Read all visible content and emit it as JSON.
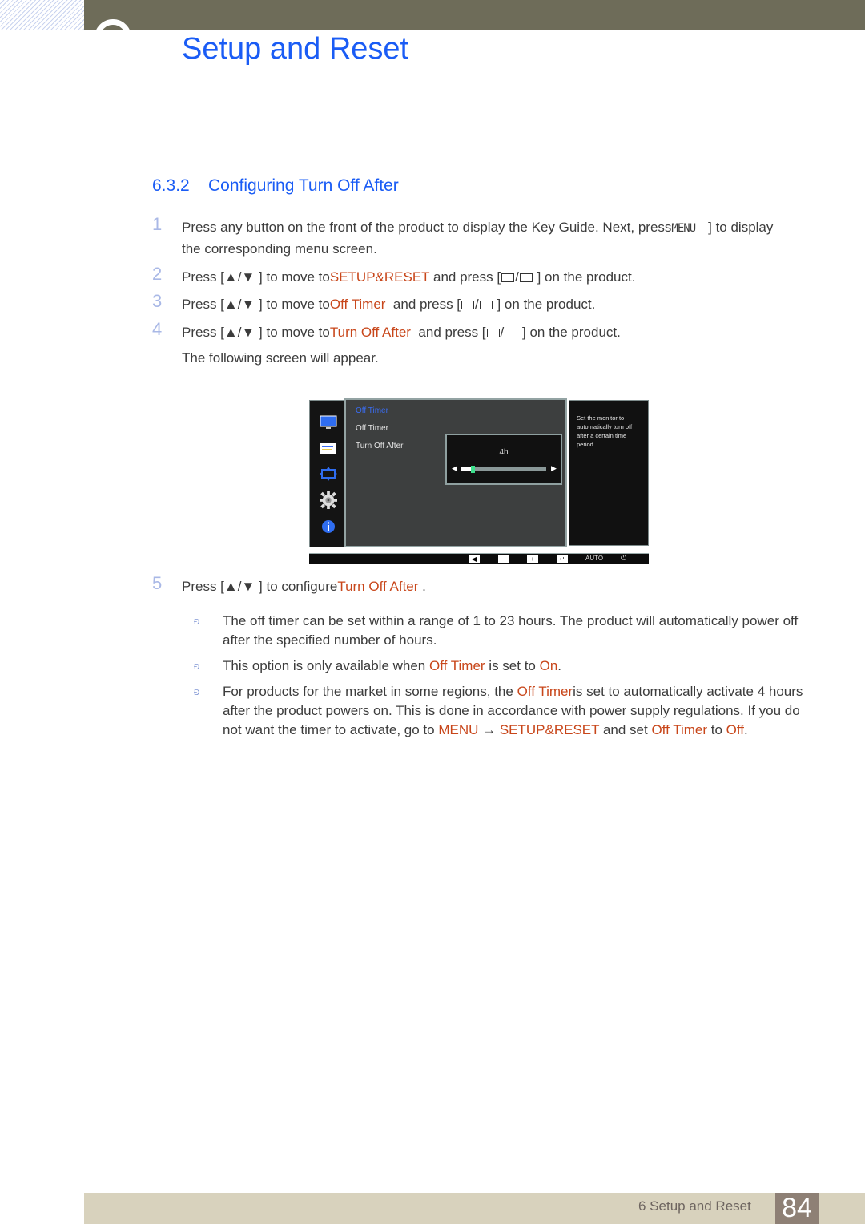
{
  "header": {
    "chapter_title": "Setup and Reset"
  },
  "section": {
    "number": "6.3.2",
    "title": "Configuring Turn Off After"
  },
  "steps": [
    {
      "num": "1",
      "line1_a": "Press any button on the front of the product to display the Key Guide. Next, press",
      "line1_key": "MENU",
      "line1_b": "] to display",
      "line2": "the corresponding menu screen."
    },
    {
      "num": "2",
      "a": "Press [",
      "up": "▲",
      "slash": "/",
      "down": "▼",
      "b": "] to move to",
      "hl": "SETUP&RESET",
      "c": "and press [",
      "d": "] on the product."
    },
    {
      "num": "3",
      "a": "Press [",
      "up": "▲",
      "slash": "/",
      "down": "▼",
      "b": "] to move to",
      "hl": "Off Timer",
      "c": "and press [",
      "d": "] on the product."
    },
    {
      "num": "4",
      "a": "Press [",
      "up": "▲",
      "slash": "/",
      "down": "▼",
      "b": "] to move to",
      "hl": "Turn Off After",
      "c": "and press [",
      "d": "] on the product."
    },
    {
      "num": "5",
      "a": "Press [",
      "up": "▲",
      "slash": "/",
      "down": "▼",
      "b": "] to configure",
      "hl": "Turn Off After",
      "c": "."
    }
  ],
  "following_screen": "The following screen will appear.",
  "osd": {
    "menu_header": "Off Timer",
    "items": [
      "Off Timer",
      "Turn Off After"
    ],
    "slider_value_label": "4h",
    "slider_value_hours": 4,
    "slider_min_hours": 1,
    "slider_max_hours": 23,
    "help_text": "Set the monitor to automatically turn off after a certain time period.",
    "side_icons": [
      "picture-icon",
      "onscreen-display-icon",
      "position-icon",
      "setup-gear-icon",
      "information-icon"
    ],
    "keys": [
      "◀",
      "−",
      "+",
      "↵",
      "AUTO",
      "⏻"
    ],
    "accent_color": "#3a6cf0",
    "thumb_color": "#3de08c"
  },
  "notes": [
    {
      "bullet": "Ð",
      "text": "The off timer can be set within a range of 1 to 23 hours. The product will automatically power off after the specified number of hours."
    },
    {
      "bullet": "Ð",
      "a": "This option is only available when ",
      "hl1": "Off Timer",
      "b": " is set to ",
      "hl2": "On",
      "c": "."
    },
    {
      "bullet": "Ð",
      "a": "For products for the market in some regions, the ",
      "hl1": "Off Timer",
      "b": "is set to automatically activate 4 hours after the product powers on. This is done in accordance with power supply regulations. If you do not want the timer to activate, go to ",
      "hl2": "MENU",
      "arrow": " → ",
      "hl3": "SETUP&RESET",
      "c": " and set ",
      "hl4": "Off Timer",
      "d": " to ",
      "hl5": "Off",
      "e": "."
    }
  ],
  "footer": {
    "chapter_label": "6 Setup and Reset",
    "page_number": "84"
  },
  "colors": {
    "link_blue": "#1a5cf5",
    "highlight_orange": "#c8461a",
    "header_bar": "#6e6c59",
    "footer_bar": "#d8d2bd",
    "page_num_bg": "#8e8075"
  }
}
